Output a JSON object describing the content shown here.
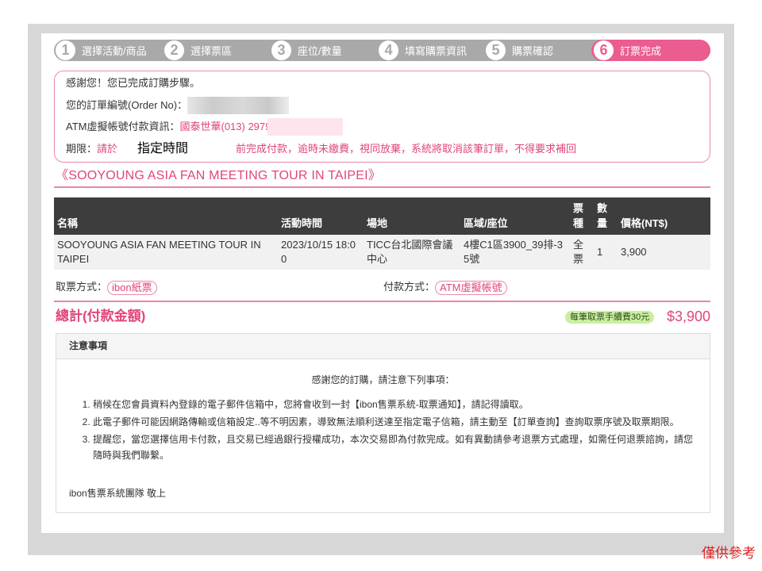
{
  "steps": [
    {
      "num": "1",
      "label": "選擇活動/商品"
    },
    {
      "num": "2",
      "label": "選擇票區"
    },
    {
      "num": "3",
      "label": "座位/數量"
    },
    {
      "num": "4",
      "label": "填寫購票資訊"
    },
    {
      "num": "5",
      "label": "購票確認"
    },
    {
      "num": "6",
      "label": "訂票完成",
      "active": true
    }
  ],
  "confirmation": {
    "thanks": "感謝您！您已完成訂購步驟。",
    "order_no_label": "您的訂單編號(Order No)：",
    "atm_label": "ATM虛擬帳號付款資訊：",
    "atm_value": "國泰世華(013) 2979",
    "deadline_label": "期限：",
    "deadline_prefix": "請於",
    "deadline_placeholder": "指定時間",
    "deadline_suffix": "前完成付款，逾時未繳費，視同放棄，系統將取消該筆訂單，不得要求補回"
  },
  "event_title": "《SOOYOUNG ASIA FAN MEETING TOUR IN TAIPEI》",
  "table": {
    "headers": [
      "名稱",
      "活動時間",
      "場地",
      "區域/座位",
      "票種",
      "數量",
      "價格(NT$)"
    ],
    "rows": [
      [
        "SOOYOUNG ASIA FAN MEETING TOUR IN TAIPEI",
        "2023/10/15 18:00",
        "TICC台北國際會議中心",
        "4樓C1區3900_39排-35號",
        "全票",
        "1",
        "3,900"
      ]
    ]
  },
  "pickup": {
    "label": "取票方式：",
    "value": "ibon紙票"
  },
  "payment": {
    "label": "付款方式：",
    "value": "ATM虛擬帳號"
  },
  "total": {
    "label": "總計(付款金額)",
    "fee_badge": "每筆取票手續費30元",
    "amount": "$3,900"
  },
  "notes": {
    "title": "注意事項",
    "intro": "感謝您的訂購，請注意下列事項：",
    "items": [
      "稍候在您會員資料內登錄的電子郵件信箱中，您將會收到一封【ibon售票系統-取票通知】，請記得讀取。",
      "此電子郵件可能因網路傳輸或信箱設定..等不明因素，導致無法順利送達至指定電子信箱，請主動至【訂單查詢】查詢取票序號及取票期限。",
      "提醒您，當您選擇信用卡付款，且交易已經過銀行授權成功，本次交易即為付款完成。如有異動請參考退票方式處理，如需任何退票諮詢，請您隨時與我們聯繫。"
    ],
    "signature": "ibon售票系統團隊 敬上"
  },
  "watermark": "僅供參考",
  "colors": {
    "accent": "#e0457b",
    "steps_bar": "#a9a9a9",
    "table_header": "#3d3d3d",
    "fee_badge_bg": "#c9ef9f",
    "watermark": "#e02020"
  }
}
